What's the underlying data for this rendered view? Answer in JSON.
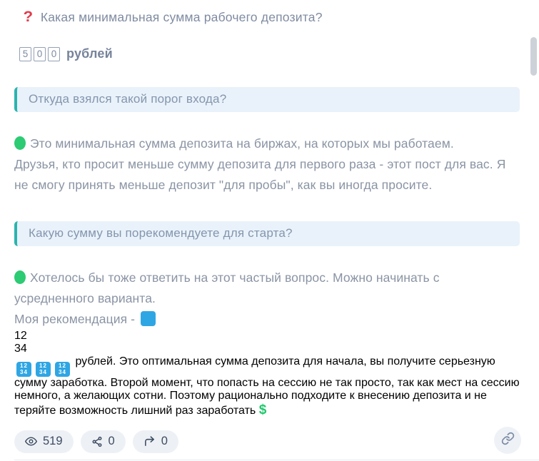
{
  "question": {
    "mark": "?",
    "text": "Какая минимальная сумма рабочего депозита?"
  },
  "deposit": {
    "digits": [
      "5",
      "0",
      "0"
    ],
    "label": "рублей"
  },
  "quotes": {
    "q1": "Откуда взялся такой порог входа?",
    "q2": "Какую сумму вы порекомендуете для старта?"
  },
  "answer1": {
    "line1": "Это минимальная сумма депозита на биржах, на которых мы работаем.",
    "line2": "Друзья, кто просит меньше сумму депозита для первого раза - этот пост для вас. Я не смогу принять меньше депозит \"для пробы\", как вы иногда просите."
  },
  "answer2": {
    "line1": "Хотелось бы тоже ответить на этот частый вопрос. Можно начинать с усредненного варианта.",
    "rec_prefix": "Моя рекомендация -",
    "keycap": {
      "top": "12",
      "bottom": "34"
    },
    "rec_suffix": "рублей. Это оптимальная сумма депозита для начала, вы получите серьезную сумму заработка. Второй момент, что попасть на сессию не так просто, так как мест на сессию немного, а желающих сотни. Поэтому рационально подходите к внесению депозита и не теряйте возможность лишний раз заработать",
    "dollar": "$"
  },
  "stats": {
    "views": "519",
    "shares": "0",
    "forwards": "0"
  },
  "colors": {
    "accent_teal": "#2ab4ae",
    "quote_bg": "#e9f2fa",
    "question_red": "#e13b4c",
    "green_circle": "#2dcb73",
    "keycap_blue": "#2fa6e4",
    "dollar_green": "#21c76d",
    "body_text": "#8a94a4",
    "pill_bg": "#edf1f6",
    "pill_text": "#3e4b61"
  }
}
